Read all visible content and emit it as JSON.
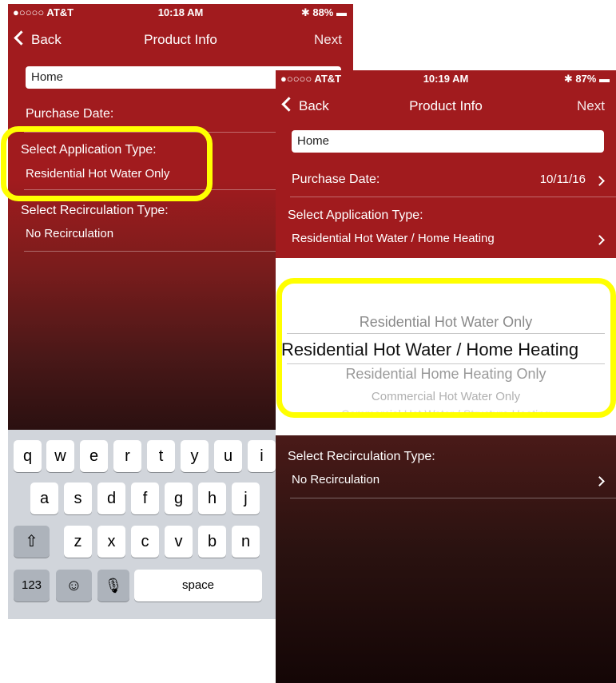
{
  "left": {
    "status": {
      "carrier": "●○○○○ AT&T",
      "time": "10:18 AM",
      "battery": "88%"
    },
    "nav": {
      "back": "Back",
      "title": "Product Info",
      "next": "Next"
    },
    "name_value": "Home",
    "purchase_label": "Purchase Date:",
    "app_label": "Select Application Type:",
    "app_value": "Residential Hot Water Only",
    "recirc_label": "Select Recirculation Type:",
    "recirc_value": "No Recirculation",
    "keyboard": {
      "row1": [
        "q",
        "w",
        "e",
        "r",
        "t",
        "y",
        "u",
        "i"
      ],
      "row2": [
        "a",
        "s",
        "d",
        "f",
        "g",
        "h",
        "j"
      ],
      "row3": [
        "z",
        "x",
        "c",
        "v",
        "b",
        "n"
      ],
      "numbers": "123",
      "space": "space"
    }
  },
  "right": {
    "status": {
      "carrier": "●○○○○ AT&T",
      "time": "10:19 AM",
      "battery": "87%"
    },
    "nav": {
      "back": "Back",
      "title": "Product Info",
      "next": "Next"
    },
    "name_value": "Home",
    "purchase_label": "Purchase Date:",
    "purchase_value": "10/11/16",
    "app_label": "Select Application Type:",
    "app_value": "Residential Hot Water / Home Heating",
    "picker": [
      "Residential Hot Water Only",
      "Residential Hot Water / Home Heating",
      "Residential Home Heating Only",
      "Commercial Hot Water Only",
      "Commercial Hot Water / Structure Heating"
    ],
    "recirc_label": "Select Recirculation Type:",
    "recirc_value": "No Recirculation"
  },
  "colors": {
    "header_red": "#a11b1e",
    "highlight": "#ffff00",
    "keyboard_bg": "#d1d5db"
  }
}
